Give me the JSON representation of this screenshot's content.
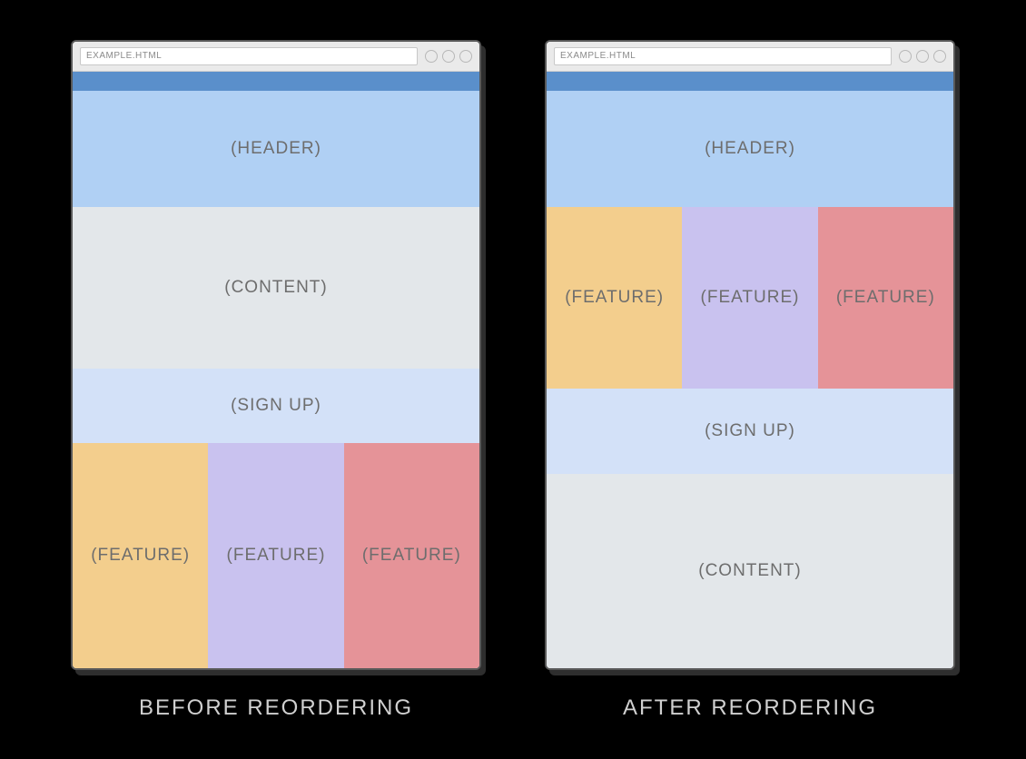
{
  "url_label": "EXAMPLE.HTML",
  "sections": {
    "header": "(HEADER)",
    "content": "(CONTENT)",
    "signup": "(SIGN UP)",
    "feature": "(FEATURE)"
  },
  "captions": {
    "before": "BEFORE REORDERING",
    "after": "AFTER REORDERING"
  },
  "colors": {
    "bluebar": "#5A8FCB",
    "header": "#B0D0F4",
    "content": "#E3E7EA",
    "signup": "#D3E1F8",
    "feature_a": "#F3CE8D",
    "feature_b": "#C9C2EF",
    "feature_c": "#E59398"
  },
  "order": {
    "before": [
      "header",
      "content",
      "signup",
      "features"
    ],
    "after": [
      "header",
      "features",
      "signup",
      "content"
    ]
  }
}
